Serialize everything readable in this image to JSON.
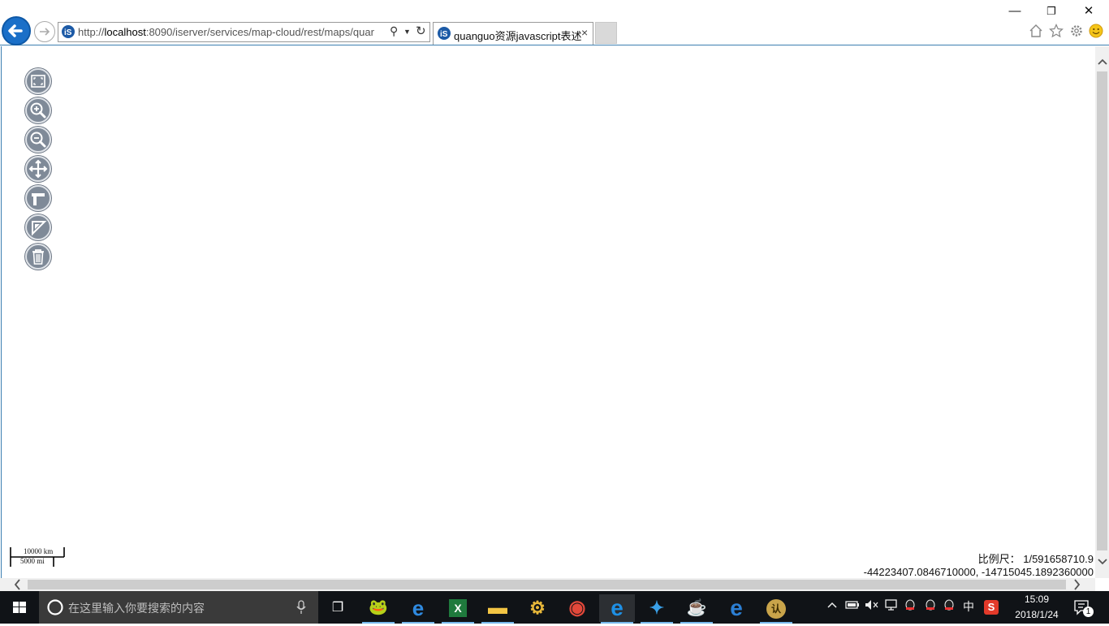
{
  "window_controls": {
    "minimize": "—",
    "restore": "❐",
    "close": "✕"
  },
  "address_bar": {
    "url": "http://localhost:8090/iserver/services/map-cloud/rest/maps/quar",
    "url_host": "localhost",
    "search_glyph": "⚲",
    "dropdown_glyph": "▼",
    "refresh_glyph": "↻"
  },
  "tab": {
    "title": "quanguo资源javascript表述",
    "close_glyph": "×"
  },
  "toolbar_icons": [
    "home-icon",
    "star-icon",
    "gear-icon",
    "smiley-icon"
  ],
  "map_controls": [
    {
      "name": "full-extent-button",
      "icon": "full-extent-icon"
    },
    {
      "name": "zoom-in-button",
      "icon": "zoom-in-icon"
    },
    {
      "name": "zoom-out-button",
      "icon": "zoom-out-icon"
    },
    {
      "name": "pan-button",
      "icon": "pan-icon"
    },
    {
      "name": "measure-distance-button",
      "icon": "measure-distance-icon"
    },
    {
      "name": "measure-area-button",
      "icon": "measure-area-icon"
    },
    {
      "name": "clear-button",
      "icon": "trash-icon"
    }
  ],
  "scale_bar": {
    "km_label": "10000 km",
    "mi_label": "5000 mi"
  },
  "map_info": {
    "scale_label": "比例尺：",
    "scale_value": "1/591658710.9",
    "coordinates": "-44223407.0846710000, -14715045.1892360000"
  },
  "taskbar": {
    "search_placeholder": "在这里输入你要搜索的内容",
    "apps": [
      {
        "name": "task-view",
        "glyph": "❐",
        "color": "#ffffff"
      },
      {
        "name": "frog-app",
        "glyph": "🐸",
        "color": "#5a9a2a"
      },
      {
        "name": "edge-app",
        "glyph": "e",
        "color": "#2f8ae0"
      },
      {
        "name": "excel-app",
        "glyph": "X",
        "color": "#1f7a3d"
      },
      {
        "name": "file-explorer-app",
        "glyph": "▬",
        "color": "#f3c544"
      },
      {
        "name": "tool-app",
        "glyph": "⚙",
        "color": "#e8b83a"
      },
      {
        "name": "chrome-app",
        "glyph": "◉",
        "color": "#e2483a"
      },
      {
        "name": "internet-explorer-app",
        "glyph": "e",
        "color": "#1e90e5"
      },
      {
        "name": "supermap-app",
        "glyph": "✦",
        "color": "#3aa0e8"
      },
      {
        "name": "java-app",
        "glyph": "☕",
        "color": "#e0682a"
      },
      {
        "name": "ie-update-app",
        "glyph": "e",
        "color": "#2c7fd4"
      },
      {
        "name": "badge-app",
        "glyph": "认",
        "color": "#c9a44a"
      }
    ],
    "tray": {
      "ime": "中",
      "sogou": "S"
    },
    "clock": {
      "time": "15:09",
      "date": "2018/1/24"
    },
    "notification_count": "1"
  }
}
